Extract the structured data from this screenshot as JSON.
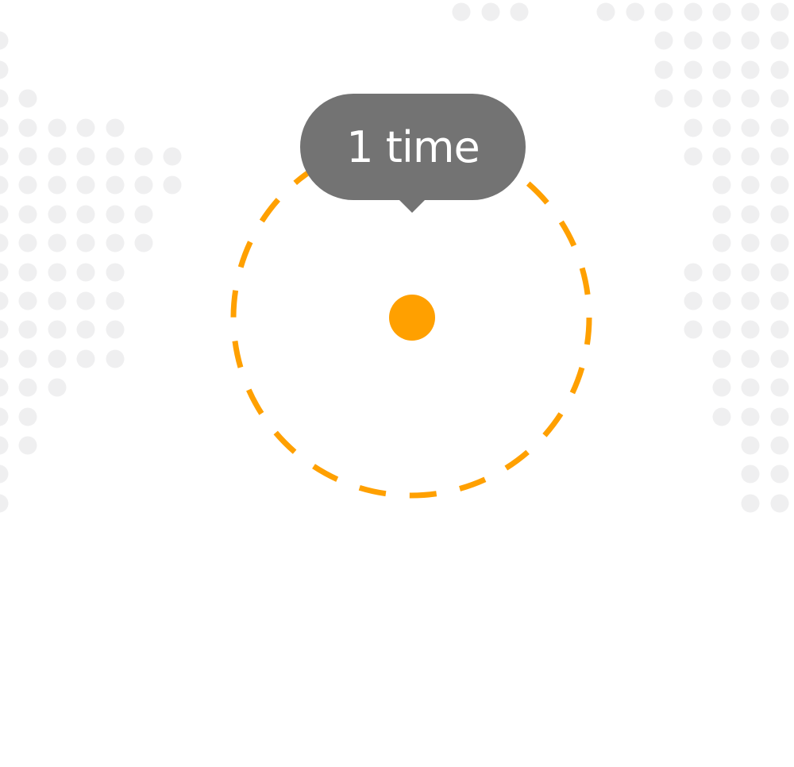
{
  "tooltip": {
    "text": "1 time"
  },
  "colors": {
    "accent": "#FFA000",
    "tooltip_bg": "#737373",
    "tooltip_text": "#FFFFFF",
    "map_dots": "#EFEFF0",
    "background": "#FFFFFF"
  },
  "icons": {
    "marker": "location-dot-icon",
    "range": "dashed-radius-ring-icon",
    "background": "dotted-world-map"
  }
}
